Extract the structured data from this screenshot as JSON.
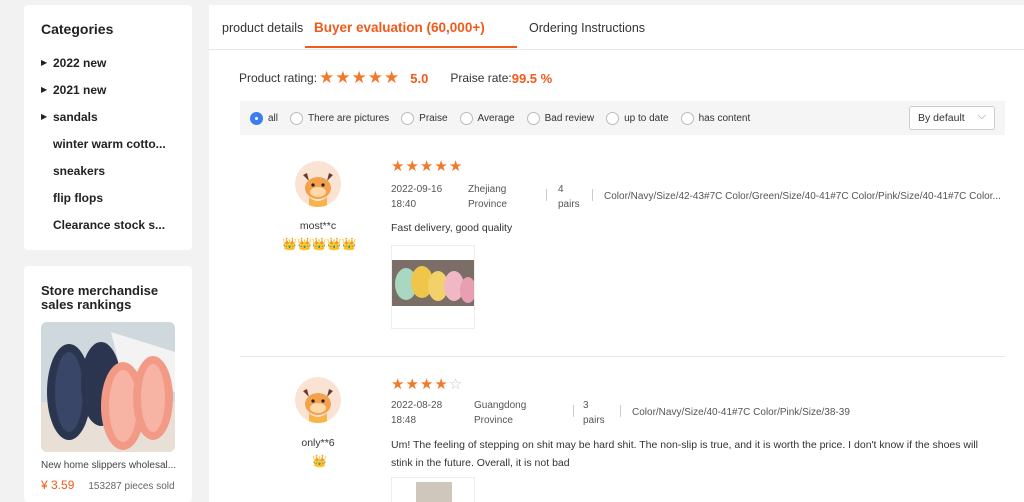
{
  "categories": {
    "title": "Categories",
    "items": [
      {
        "label": "2022 new",
        "has_arrow": true
      },
      {
        "label": "2021 new",
        "has_arrow": true
      },
      {
        "label": "sandals",
        "has_arrow": true
      },
      {
        "label": "winter warm cotto...",
        "has_arrow": false
      },
      {
        "label": "sneakers",
        "has_arrow": false
      },
      {
        "label": "flip flops",
        "has_arrow": false
      },
      {
        "label": "Clearance stock s...",
        "has_arrow": false
      }
    ]
  },
  "rankings": {
    "title": "Store merchandise sales rankings",
    "product": {
      "name": "New home slippers wholesal...",
      "price": "¥ 3.59",
      "sold": "153287 pieces sold"
    }
  },
  "tabs": [
    {
      "label": "product details",
      "active": false
    },
    {
      "label": "Buyer evaluation (60,000+)",
      "active": true
    },
    {
      "label": "Ordering Instructions",
      "active": false
    }
  ],
  "summary": {
    "rating_label": "Product rating:",
    "rating_stars": 5,
    "rating_value": "5.0",
    "praise_label": "Praise rate:",
    "praise_value": "99.5 %"
  },
  "filters": [
    {
      "label": "all",
      "checked": true
    },
    {
      "label": "There are pictures",
      "checked": false
    },
    {
      "label": "Praise",
      "checked": false
    },
    {
      "label": "Average",
      "checked": false
    },
    {
      "label": "Bad review",
      "checked": false
    },
    {
      "label": "up to date",
      "checked": false
    },
    {
      "label": "has content",
      "checked": false
    }
  ],
  "sort": {
    "selected": "By default"
  },
  "reviews": [
    {
      "user": "most**c",
      "badge_count": 5,
      "stars": 5,
      "date": "2022-09-16",
      "time": "18:40",
      "region_line1": "Zhejiang",
      "region_line2": "Province",
      "qty_line1": "4",
      "qty_line2": "pairs",
      "spec": "Color/Navy/Size/42-43#7C Color/Green/Size/40-41#7C Color/Pink/Size/40-41#7C Color...",
      "text": "Fast delivery, good quality"
    },
    {
      "user": "only**6",
      "badge_count": 1,
      "stars": 4,
      "date": "2022-08-28",
      "time": "18:48",
      "region_line1": "Guangdong",
      "region_line2": "Province",
      "qty_line1": "3",
      "qty_line2": "pairs",
      "spec": "Color/Navy/Size/40-41#7C Color/Pink/Size/38-39",
      "text": "Um! The feeling of stepping on shit may be hard shit. The non-slip is true, and it is worth the price. I don't know if the shoes will stink in the future. Overall, it is not bad"
    }
  ],
  "colors": {
    "accent": "#f05a1a",
    "star": "#f07a2a",
    "radio_checked": "#3d7df0"
  }
}
